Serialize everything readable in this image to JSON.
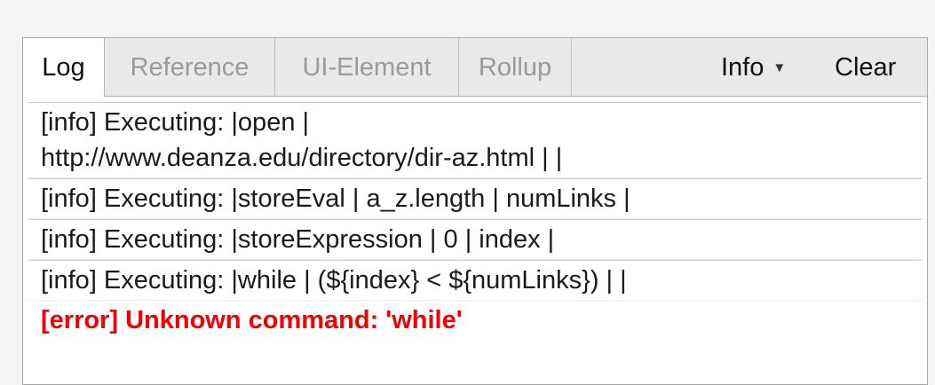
{
  "tabs": [
    {
      "label": "Log",
      "active": true
    },
    {
      "label": "Reference",
      "active": false
    },
    {
      "label": "UI-Element",
      "active": false
    },
    {
      "label": "Rollup",
      "active": false
    }
  ],
  "toolbar": {
    "level_select": {
      "value": "Info",
      "icon": "caret-down-icon"
    },
    "clear_label": "Clear"
  },
  "log": {
    "entries": [
      {
        "level": "info",
        "line1": "[info] Executing: |open |",
        "line2": "http://www.deanza.edu/directory/dir-az.html | |"
      },
      {
        "level": "info",
        "line1": "[info] Executing: |storeEval | a_z.length | numLinks |"
      },
      {
        "level": "info",
        "line1": "[info] Executing: |storeExpression | 0 | index |"
      },
      {
        "level": "info",
        "line1": "[info] Executing: |while | (${index} < ${numLinks}) | |"
      },
      {
        "level": "error",
        "line1": "[error] Unknown command: 'while'"
      }
    ]
  },
  "colors": {
    "error": "#f20000",
    "active_tab_bg": "#ffffff",
    "tabbar_bg": "#e9e9e9"
  }
}
